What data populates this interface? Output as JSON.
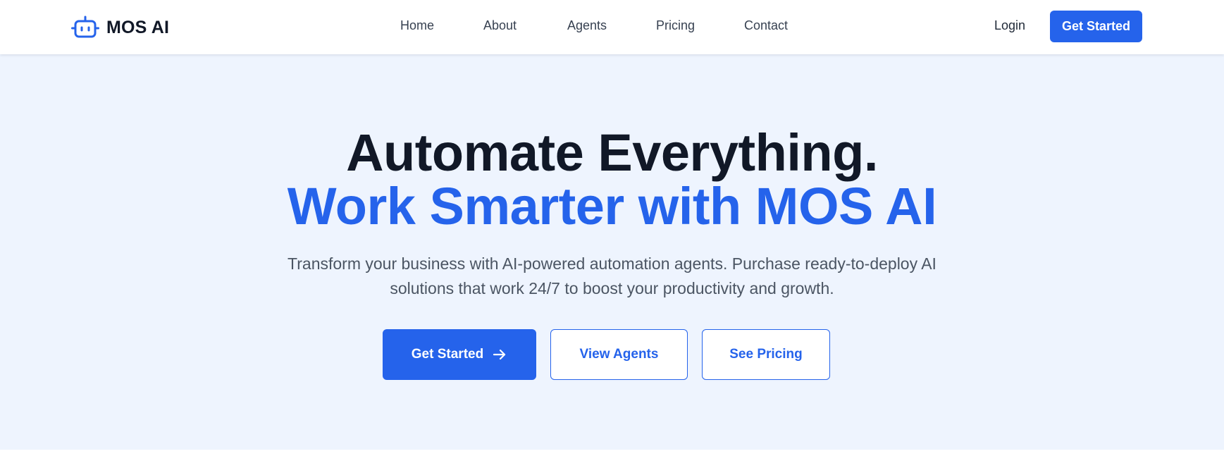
{
  "brand": {
    "name": "MOS AI",
    "icon": "robot-icon",
    "accent_color": "#2563eb"
  },
  "nav": {
    "links": [
      {
        "label": "Home"
      },
      {
        "label": "About"
      },
      {
        "label": "Agents"
      },
      {
        "label": "Pricing"
      },
      {
        "label": "Contact"
      }
    ],
    "login_label": "Login",
    "cta_label": "Get Started"
  },
  "hero": {
    "headline_line1": "Automate Everything.",
    "headline_line2": "Work Smarter with MOS AI",
    "subtitle": "Transform your business with AI-powered automation agents. Purchase ready-to-deploy AI solutions that work 24/7 to boost your productivity and growth.",
    "buttons": {
      "primary_label": "Get Started",
      "primary_icon": "arrow-right-icon",
      "agents_label": "View Agents",
      "pricing_label": "See Pricing"
    },
    "background_color": "#eef4fe",
    "headline_color": "#111827",
    "highlight_color": "#2563eb"
  }
}
